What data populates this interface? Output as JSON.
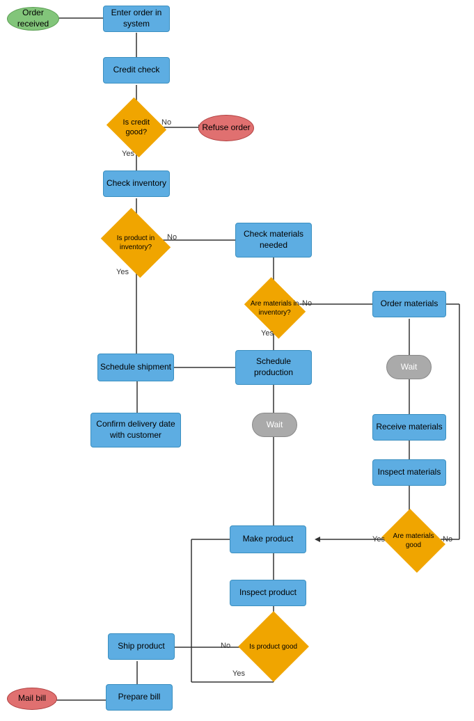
{
  "nodes": {
    "order_received": {
      "label": "Order received"
    },
    "enter_order": {
      "label": "Enter order in system"
    },
    "credit_check": {
      "label": "Credit check"
    },
    "is_credit_good": {
      "label": "Is credit good?"
    },
    "refuse_order": {
      "label": "Refuse order"
    },
    "check_inventory": {
      "label": "Check inventory"
    },
    "is_product_in_inventory": {
      "label": "Is product in inventory?"
    },
    "check_materials_needed": {
      "label": "Check materials needed"
    },
    "are_materials_in_inventory": {
      "label": "Are materials in inventory?"
    },
    "order_materials": {
      "label": "Order materials"
    },
    "wait1": {
      "label": "Wait"
    },
    "receive_materials": {
      "label": "Receive materials"
    },
    "inspect_materials": {
      "label": "Inspect materials"
    },
    "are_materials_good": {
      "label": "Are materials good"
    },
    "schedule_production": {
      "label": "Schedule production"
    },
    "wait2": {
      "label": "Wait"
    },
    "schedule_shipment": {
      "label": "Schedule shipment"
    },
    "confirm_delivery": {
      "label": "Confirm delivery date with customer"
    },
    "make_product": {
      "label": "Make product"
    },
    "inspect_product": {
      "label": "Inspect product"
    },
    "is_product_good": {
      "label": "Is product good"
    },
    "ship_product": {
      "label": "Ship product"
    },
    "prepare_bill": {
      "label": "Prepare bill"
    },
    "mail_bill": {
      "label": "Mail bill"
    }
  },
  "labels": {
    "no1": "No",
    "yes1": "Yes",
    "no2": "No",
    "yes2": "Yes",
    "no3": "No",
    "yes3": "Yes",
    "no4": "No",
    "yes4": "Yes",
    "no5": "No",
    "yes5": "Yes"
  }
}
